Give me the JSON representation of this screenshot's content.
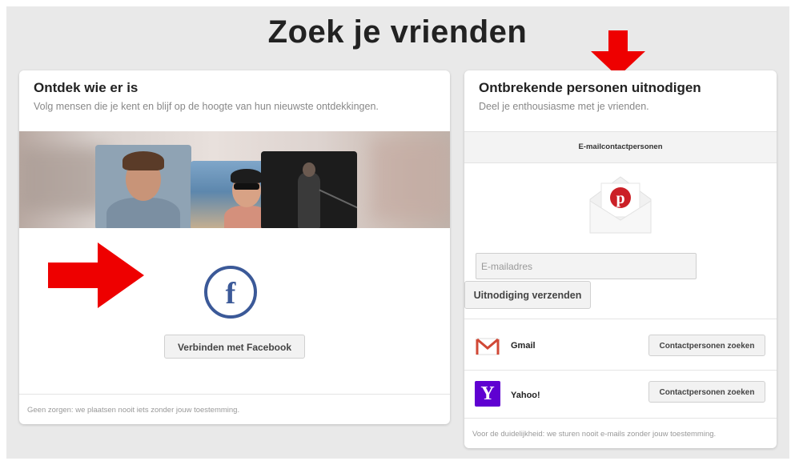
{
  "page": {
    "title": "Zoek je vrienden"
  },
  "discover": {
    "title": "Ontdek wie er is",
    "subtitle": "Volg mensen die je kent en blijf op de hoogte van hun nieuwste ontdekkingen.",
    "facebook_icon_glyph": "f",
    "facebook_button": "Verbinden met Facebook",
    "footer": "Geen zorgen: we plaatsen nooit iets zonder jouw toestemming."
  },
  "invite": {
    "title": "Ontbrekende personen uitnodigen",
    "subtitle": "Deel je enthousiasme met je vrienden.",
    "tab_label": "E-mailcontactpersonen",
    "email_placeholder": "E-mailadres",
    "send_button": "Uitnodiging verzenden",
    "services": [
      {
        "name": "Gmail",
        "button": "Contactpersonen zoeken",
        "icon": "gmail-icon",
        "color": "#d14836"
      },
      {
        "name": "Yahoo!",
        "button": "Contactpersonen zoeken",
        "icon": "yahoo-icon",
        "color": "#5f01d1"
      }
    ],
    "footer": "Voor de duidelijkheid: we sturen nooit e-mails zonder jouw toestemming."
  },
  "colors": {
    "facebook": "#3b5998",
    "pinterest": "#cb2027",
    "annotation_arrow": "#ee0000"
  }
}
